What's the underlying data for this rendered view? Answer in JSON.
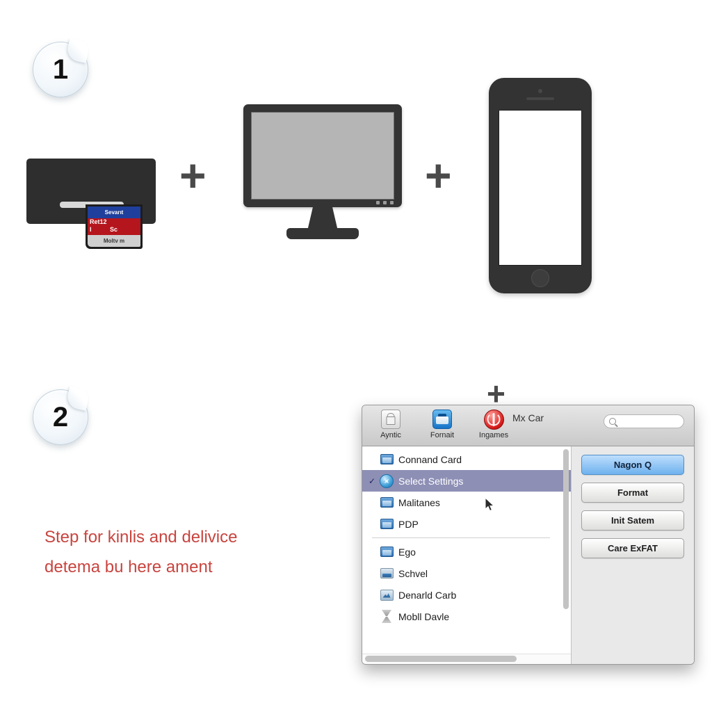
{
  "steps": [
    {
      "number": "1"
    },
    {
      "number": "2"
    }
  ],
  "separators": {
    "plus": "+"
  },
  "hardware": {
    "card_reader": {
      "name": "sd-card-reader",
      "sd_card": {
        "line_blue": "Sevarıt",
        "line_red_1": "Ret12",
        "line_red_2": "I",
        "line_red_3": "Sc",
        "line_gray": "Moltv m"
      }
    },
    "monitor": {
      "name": "computer-monitor"
    },
    "phone": {
      "name": "smartphone"
    }
  },
  "caption": {
    "line1": "Step for kinlis and delivice",
    "line2": "detema bu here ament",
    "color": "#c8443f"
  },
  "dialog": {
    "title": "Mx Car",
    "toolbar": [
      {
        "label": "Ayntic",
        "icon": "lock-icon"
      },
      {
        "label": "Fornait",
        "icon": "disk-icon"
      },
      {
        "label": "Ingames",
        "icon": "eject-icon"
      }
    ],
    "search": {
      "value": "",
      "placeholder": ""
    },
    "list": [
      {
        "label": "Connand Card",
        "icon": "folder-icon",
        "selected": false,
        "checked": false
      },
      {
        "label": "Select Settings",
        "icon": "gear-icon",
        "selected": true,
        "checked": true
      },
      {
        "label": "Malitanes",
        "icon": "folder-icon",
        "selected": false,
        "checked": false
      },
      {
        "label": "PDP",
        "icon": "folder-icon",
        "selected": false,
        "checked": false
      },
      {
        "label": "Ego",
        "icon": "folder-icon",
        "selected": false,
        "checked": false
      },
      {
        "label": "Schvel",
        "icon": "disk-gray-icon",
        "selected": false,
        "checked": false
      },
      {
        "label": "Denarld Carb",
        "icon": "network-disk-icon",
        "selected": false,
        "checked": false
      },
      {
        "label": "Mobll Davle",
        "icon": "hourglass-icon",
        "selected": false,
        "checked": false
      }
    ],
    "buttons": [
      {
        "label": "Nagon Q",
        "primary": true
      },
      {
        "label": "Format",
        "primary": false
      },
      {
        "label": "Init Satem",
        "primary": false
      },
      {
        "label": "Care ExFAT",
        "primary": false
      }
    ],
    "accent_selected": "#8d8fb5",
    "accent_primary_button": "#6fb2ef"
  }
}
